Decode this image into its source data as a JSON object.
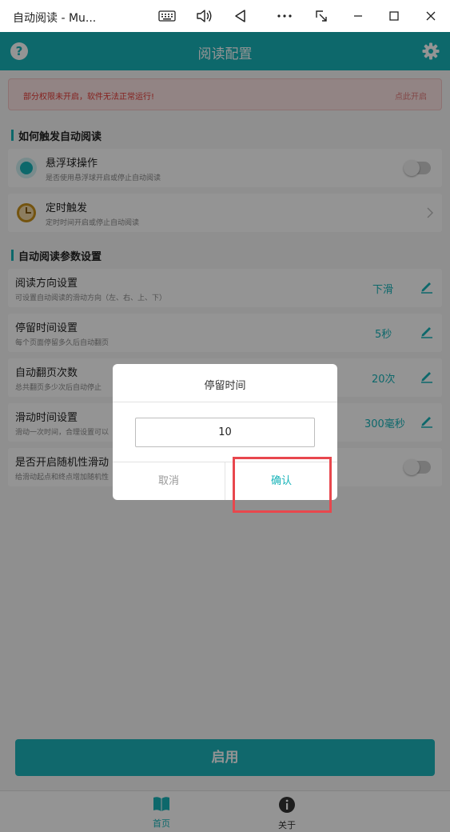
{
  "window": {
    "title": "自动阅读 - Mu...",
    "icons": [
      "keyboard-icon",
      "volume-icon",
      "back-icon",
      "more-icon",
      "resize-icon",
      "minimize-icon",
      "maximize-icon",
      "close-icon"
    ]
  },
  "colors": {
    "accent": "#17b3b9",
    "warning_text": "#e53935",
    "warning_bg": "#fbe3e3",
    "highlight": "#e8474d"
  },
  "appbar": {
    "title": "阅读配置",
    "help_icon_text": "?"
  },
  "warning": {
    "text": "部分权限未开启，软件无法正常运行!",
    "link": "点此开启"
  },
  "sections": {
    "trigger": "如何触发自动阅读",
    "params": "自动阅读参数设置"
  },
  "trigger_items": [
    {
      "title": "悬浮球操作",
      "subtitle": "是否使用悬浮球开启或停止自动阅读",
      "icon": "float-ball-icon",
      "toggle_on": false
    },
    {
      "title": "定时触发",
      "subtitle": "定时时间开启或停止自动阅读",
      "icon": "clock-icon"
    }
  ],
  "param_items": [
    {
      "title": "阅读方向设置",
      "subtitle": "可设置自动阅读的滑动方向（左、右、上、下）",
      "value": "下滑"
    },
    {
      "title": "停留时间设置",
      "subtitle": "每个页面停留多久后自动翻页",
      "value": "5秒"
    },
    {
      "title": "自动翻页次数",
      "subtitle": "总共翻页多少次后自动停止",
      "value": "20次"
    },
    {
      "title": "滑动时间设置",
      "subtitle": "滑动一次时间，合理设置可以",
      "value": "300毫秒"
    },
    {
      "title": "是否开启随机性滑动",
      "subtitle": "给滑动起点和终点增加随机性",
      "toggle_on": false
    }
  ],
  "enable_button": "启用",
  "bottom_nav": [
    {
      "label": "首页",
      "icon": "book-icon",
      "active": true
    },
    {
      "label": "关于",
      "icon": "info-icon",
      "active": false
    }
  ],
  "dialog": {
    "title": "停留时间",
    "input_value": "10",
    "cancel": "取消",
    "confirm": "确认"
  }
}
